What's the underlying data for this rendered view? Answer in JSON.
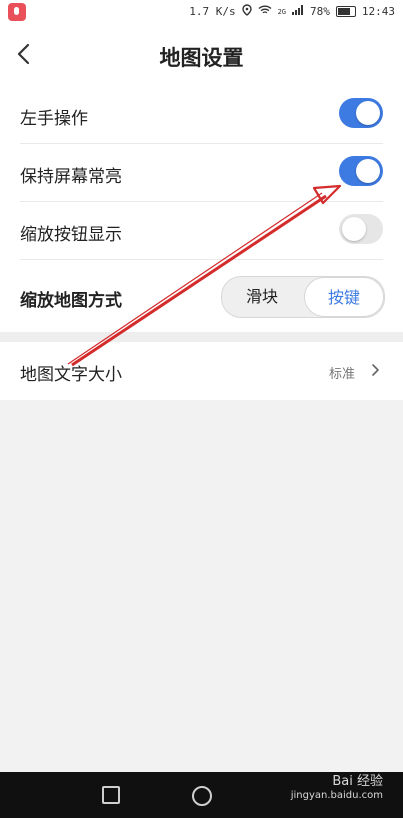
{
  "status_bar": {
    "network_speed": "1.7 K/s",
    "network_type": "2G",
    "battery": "78%",
    "time": "12:43"
  },
  "header": {
    "title": "地图设置"
  },
  "settings": {
    "left_hand": {
      "label": "左手操作",
      "enabled": true
    },
    "keep_screen_on": {
      "label": "保持屏幕常亮",
      "enabled": true
    },
    "zoom_buttons": {
      "label": "缩放按钮显示",
      "enabled": false
    },
    "zoom_mode": {
      "label": "缩放地图方式",
      "options": [
        "滑块",
        "按键"
      ],
      "selected": "按键"
    }
  },
  "font_size": {
    "label": "地图文字大小",
    "value": "标准"
  },
  "watermark": {
    "brand": "Bai 经验",
    "url": "jingyan.baidu.com"
  }
}
